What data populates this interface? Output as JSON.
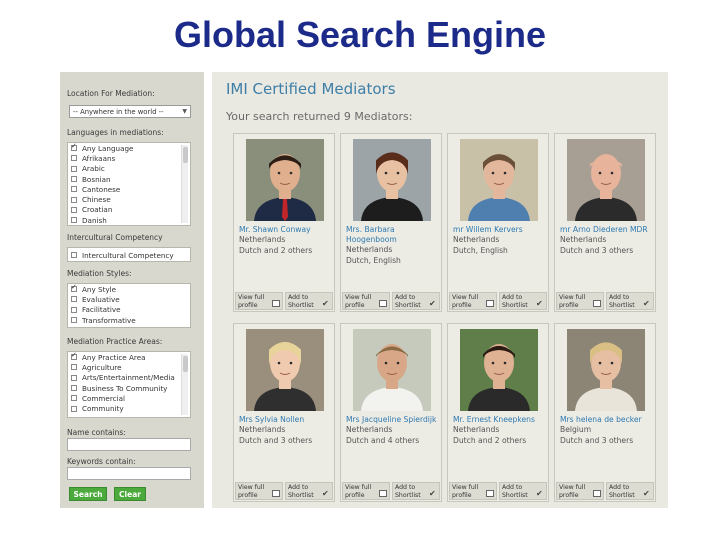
{
  "slide_title": "Global Search Engine",
  "sidebar": {
    "location_label": "Location For Mediation:",
    "location_value": "-- Anywhere in the world --",
    "languages_label": "Languages in mediations:",
    "languages": [
      {
        "label": "Any Language",
        "checked": true
      },
      {
        "label": "Afrikaans",
        "checked": false
      },
      {
        "label": "Arabic",
        "checked": false
      },
      {
        "label": "Bosnian",
        "checked": false
      },
      {
        "label": "Cantonese",
        "checked": false
      },
      {
        "label": "Chinese",
        "checked": false
      },
      {
        "label": "Croatian",
        "checked": false
      },
      {
        "label": "Danish",
        "checked": false
      }
    ],
    "intercultural_label": "Intercultural Competency",
    "intercultural_option": "Intercultural Competency",
    "styles_label": "Mediation Styles:",
    "styles": [
      {
        "label": "Any Style",
        "checked": true
      },
      {
        "label": "Evaluative",
        "checked": false
      },
      {
        "label": "Facilitative",
        "checked": false
      },
      {
        "label": "Transformative",
        "checked": false
      }
    ],
    "practice_label": "Mediation Practice Areas:",
    "practice_areas": [
      {
        "label": "Any Practice Area",
        "checked": true
      },
      {
        "label": "Agriculture",
        "checked": false
      },
      {
        "label": "Arts/Entertainment/Media",
        "checked": false
      },
      {
        "label": "Business To Community",
        "checked": false
      },
      {
        "label": "Commercial",
        "checked": false
      },
      {
        "label": "Community",
        "checked": false
      }
    ],
    "name_label": "Name contains:",
    "keywords_label": "Keywords contain:",
    "search_button": "Search",
    "clear_button": "Clear"
  },
  "main": {
    "title": "IMI Certified Mediators",
    "result_text": "Your search returned 9 Mediators:",
    "view_label_1": "View full",
    "view_label_2": "profile",
    "add_label_1": "Add to",
    "add_label_2": "Shortlist",
    "mediators": [
      {
        "name": "Mr. Shawn Conway",
        "details": [
          "Netherlands",
          "Dutch and 2 others"
        ]
      },
      {
        "name": "Mrs. Barbara Hoogenboom",
        "details": [
          "Netherlands",
          "Dutch, English"
        ]
      },
      {
        "name": "mr Willem Kervers",
        "details": [
          "Netherlands",
          "Dutch, English"
        ]
      },
      {
        "name": "mr Arno Diederen MDR",
        "details": [
          "Netherlands",
          "Dutch and 3 others"
        ]
      },
      {
        "name": "Mrs Sylvia Nollen",
        "details": [
          "Netherlands",
          "Dutch and 3 others"
        ]
      },
      {
        "name": "Mrs Jacqueline Spierdijk",
        "details": [
          "Netherlands",
          "Dutch and 4 others"
        ]
      },
      {
        "name": "Mr. Ernest Kneepkens",
        "details": [
          "Netherlands",
          "Dutch and 2 others"
        ]
      },
      {
        "name": "Mrs helena de becker",
        "details": [
          "Belgium",
          "Dutch and 3 others"
        ]
      }
    ]
  },
  "colors": {
    "title_blue": "#1c2a8a",
    "link_blue": "#2f7ab0",
    "heading_blue": "#3e7fa8",
    "button_green": "#4caa3d",
    "sidebar_bg": "#d9d8cf",
    "panel_bg": "#e9e8e1"
  }
}
